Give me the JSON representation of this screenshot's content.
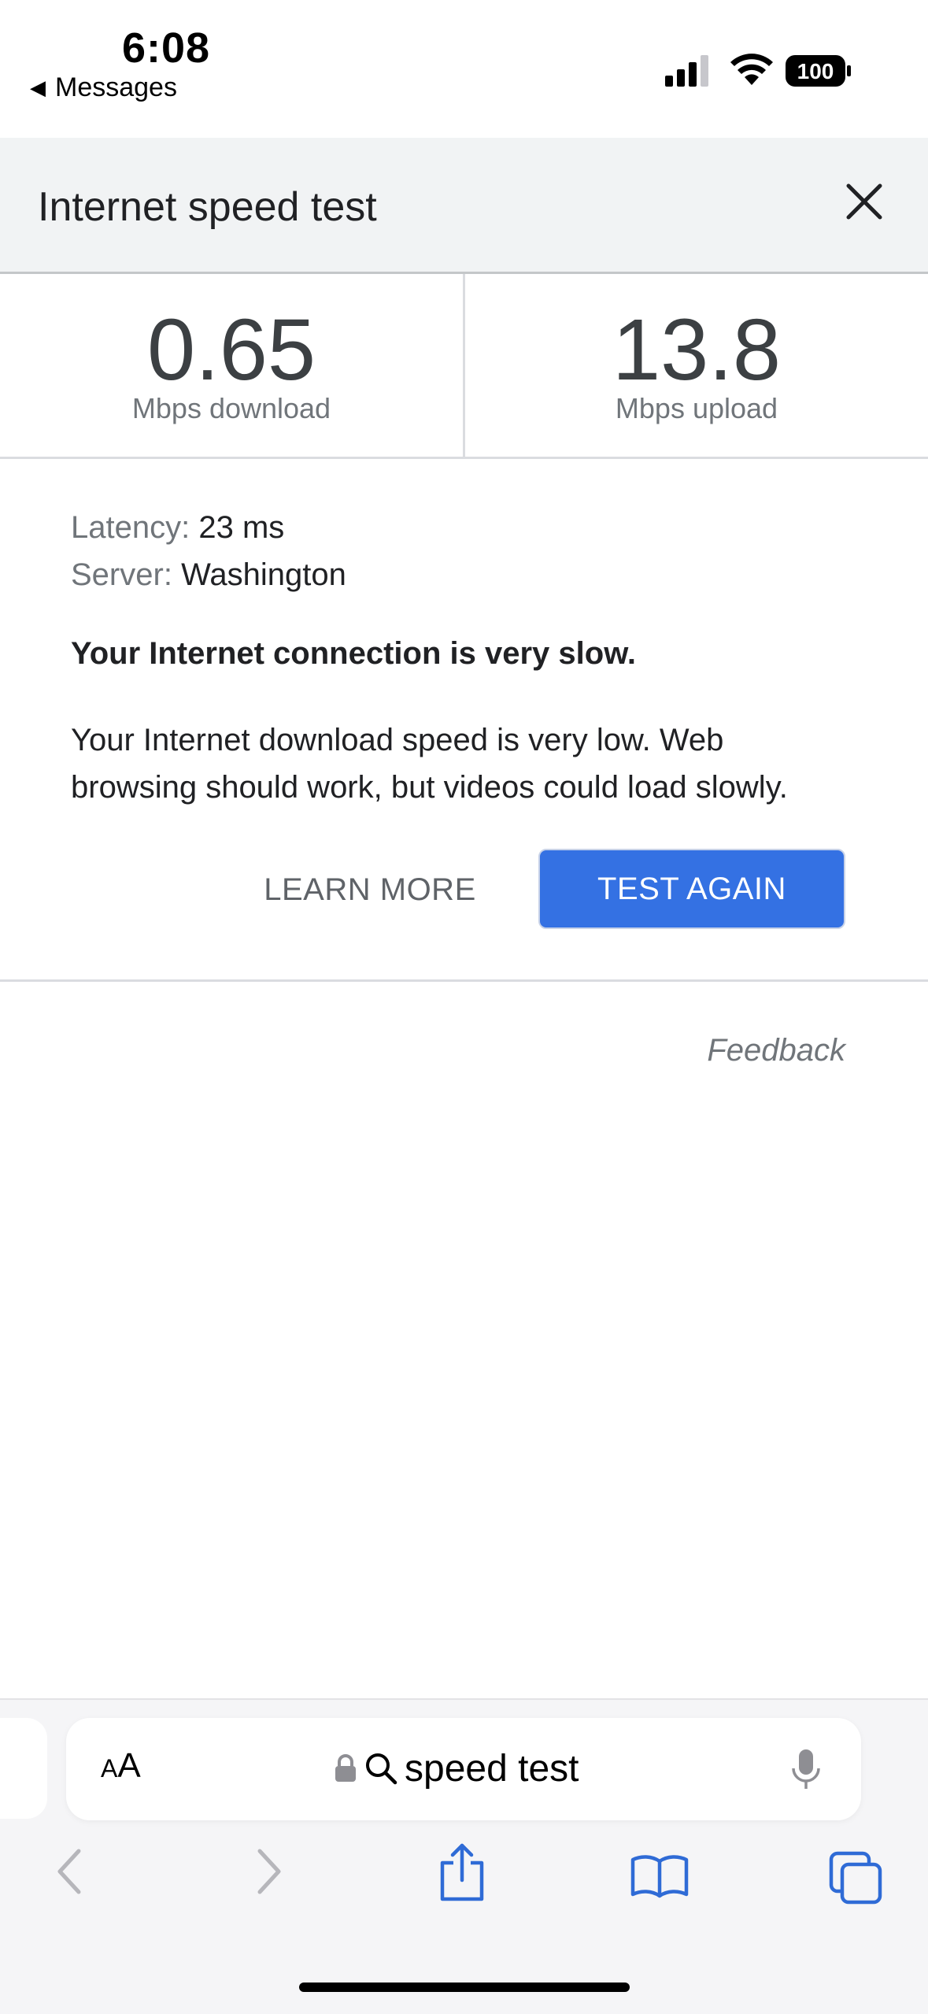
{
  "status_bar": {
    "time": "6:08",
    "back_app": "Messages",
    "battery_level": "100"
  },
  "card": {
    "title": "Internet speed test"
  },
  "results": {
    "download_value": "0.65",
    "download_label": "Mbps download",
    "upload_value": "13.8",
    "upload_label": "Mbps upload",
    "latency_key": "Latency:",
    "latency_value": "23 ms",
    "server_key": "Server:",
    "server_value": "Washington",
    "headline": "Your Internet connection is very slow.",
    "description": "Your Internet download speed is very low. Web browsing should work, but videos could load slowly.",
    "learn_more_label": "LEARN MORE",
    "test_again_label": "TEST AGAIN",
    "feedback_label": "Feedback"
  },
  "address_bar": {
    "aa_small": "A",
    "aa_large": "A",
    "url_text": "speed test"
  },
  "colors": {
    "accent": "#3471e3",
    "header_bg": "#f1f3f4",
    "toolbar_icon": "#2f6bd6",
    "disabled_icon": "#b6b6bb"
  },
  "icons": {
    "status": [
      "signal-icon",
      "wifi-icon",
      "battery-icon"
    ],
    "toolbar": [
      "back-icon",
      "forward-icon",
      "share-icon",
      "bookmarks-icon",
      "tabs-icon"
    ]
  }
}
